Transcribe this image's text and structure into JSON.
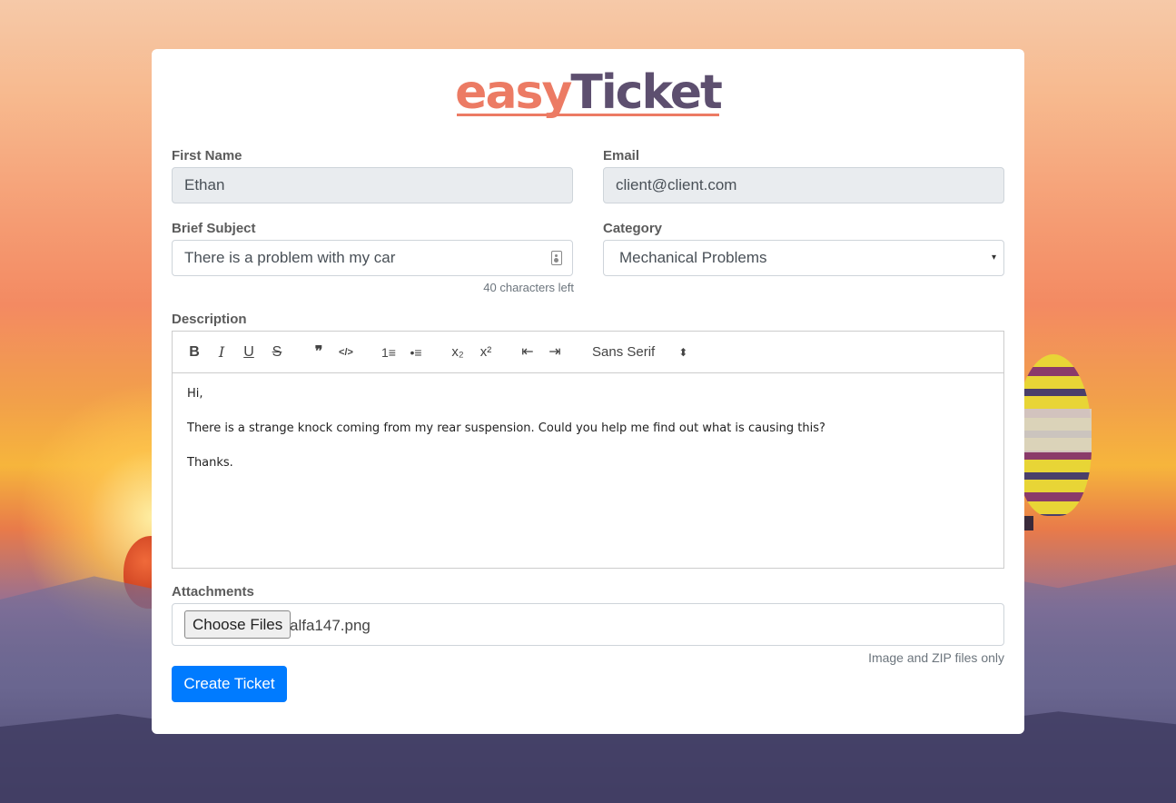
{
  "brand": {
    "easy": "easy",
    "ticket": "Ticket"
  },
  "form": {
    "first_name": {
      "label": "First Name",
      "value": "Ethan"
    },
    "email": {
      "label": "Email",
      "value": "client@client.com"
    },
    "subject": {
      "label": "Brief Subject",
      "value": "There is a problem with my car",
      "hint": "40 characters left"
    },
    "category": {
      "label": "Category",
      "value": "Mechanical Problems",
      "caret": "▾"
    },
    "description": {
      "label": "Description",
      "toolbar": {
        "bold": "B",
        "italic": "I",
        "underline": "U",
        "strike": "S",
        "blockquote": "❞",
        "code": "</>",
        "ordered_list": "1≡",
        "bullet_list": "•≡",
        "subscript": "x₂",
        "superscript": "x²",
        "outdent": "⇤",
        "indent": "⇥",
        "font": "Sans Serif",
        "font_caret": "⬍"
      },
      "body": {
        "line1": "Hi,",
        "line2": "There is a strange knock coming from my rear suspension. Could you help me find out what is causing this?",
        "line3": "Thanks."
      }
    },
    "attachments": {
      "label": "Attachments",
      "button": "Choose Files",
      "file": "alfa147.png",
      "hint": "Image and ZIP files only"
    },
    "submit": "Create Ticket"
  }
}
